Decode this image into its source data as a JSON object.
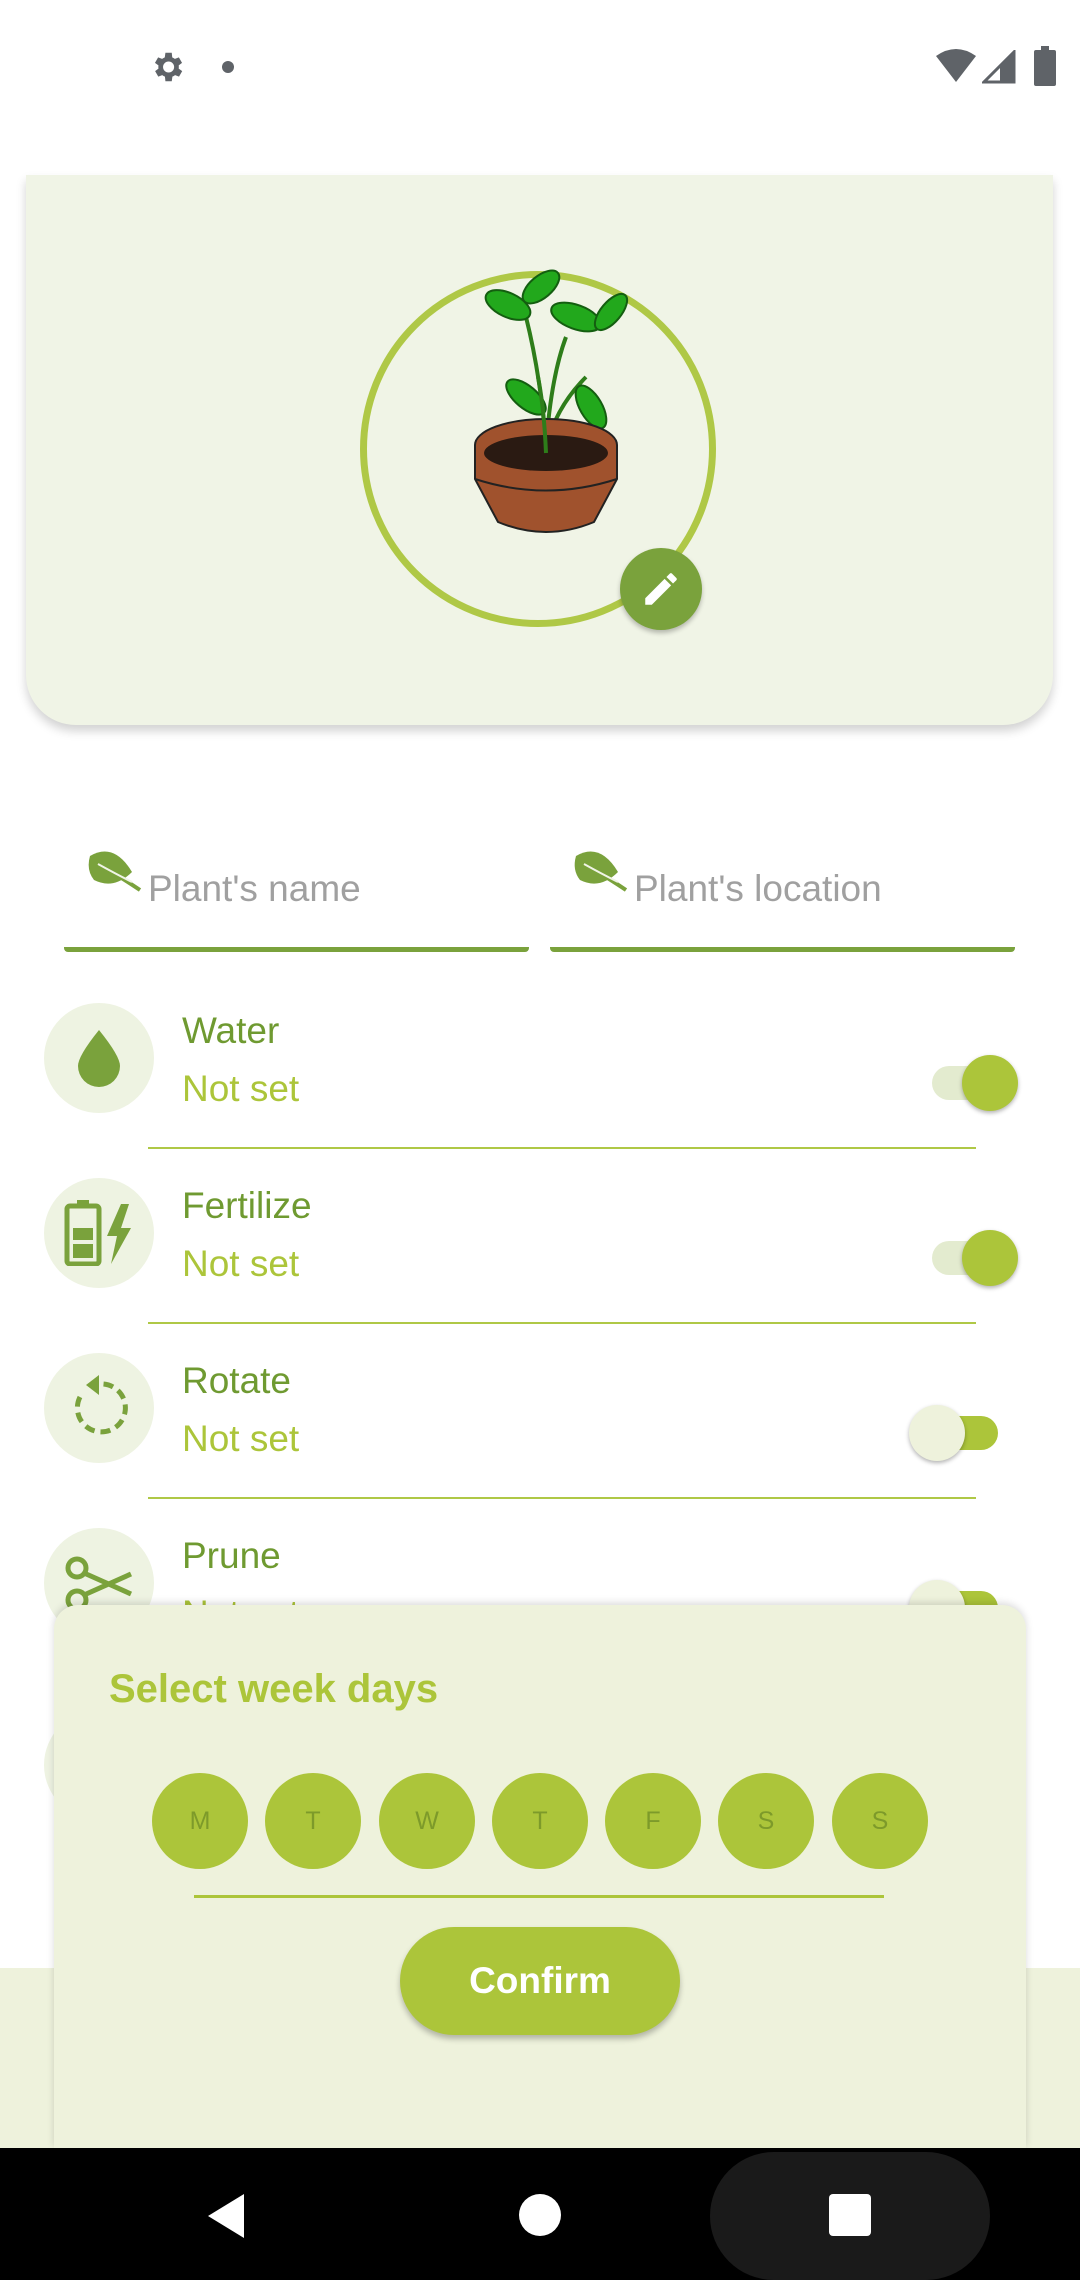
{
  "status_bar": {
    "left_icons": [
      "gear-icon",
      "notification-dot-icon"
    ],
    "right_icons": [
      "wifi-icon",
      "signal-icon",
      "battery-icon"
    ]
  },
  "header": {
    "image": "plant-pot-image",
    "edit_icon": "pencil-icon"
  },
  "fields": {
    "name_placeholder": "Plant's name",
    "location_placeholder": "Plant's location"
  },
  "tasks": [
    {
      "title": "Water",
      "value": "Not set",
      "icon": "water-drop-icon",
      "enabled": true
    },
    {
      "title": "Fertilize",
      "value": "Not set",
      "icon": "battery-bolt-icon",
      "enabled": true
    },
    {
      "title": "Rotate",
      "value": "Not set",
      "icon": "rotate-icon",
      "enabled": false
    },
    {
      "title": "Prune",
      "value": "Not set",
      "icon": "scissors-icon",
      "enabled": false
    }
  ],
  "dialog": {
    "title": "Select week days",
    "days": [
      "M",
      "T",
      "W",
      "T",
      "F",
      "S",
      "S"
    ],
    "confirm_label": "Confirm"
  },
  "colors": {
    "primary_dark": "#7aa23c",
    "primary_light": "#acc53a",
    "surface": "#eef2dc"
  },
  "nav": [
    "back-icon",
    "home-icon",
    "recents-icon"
  ]
}
